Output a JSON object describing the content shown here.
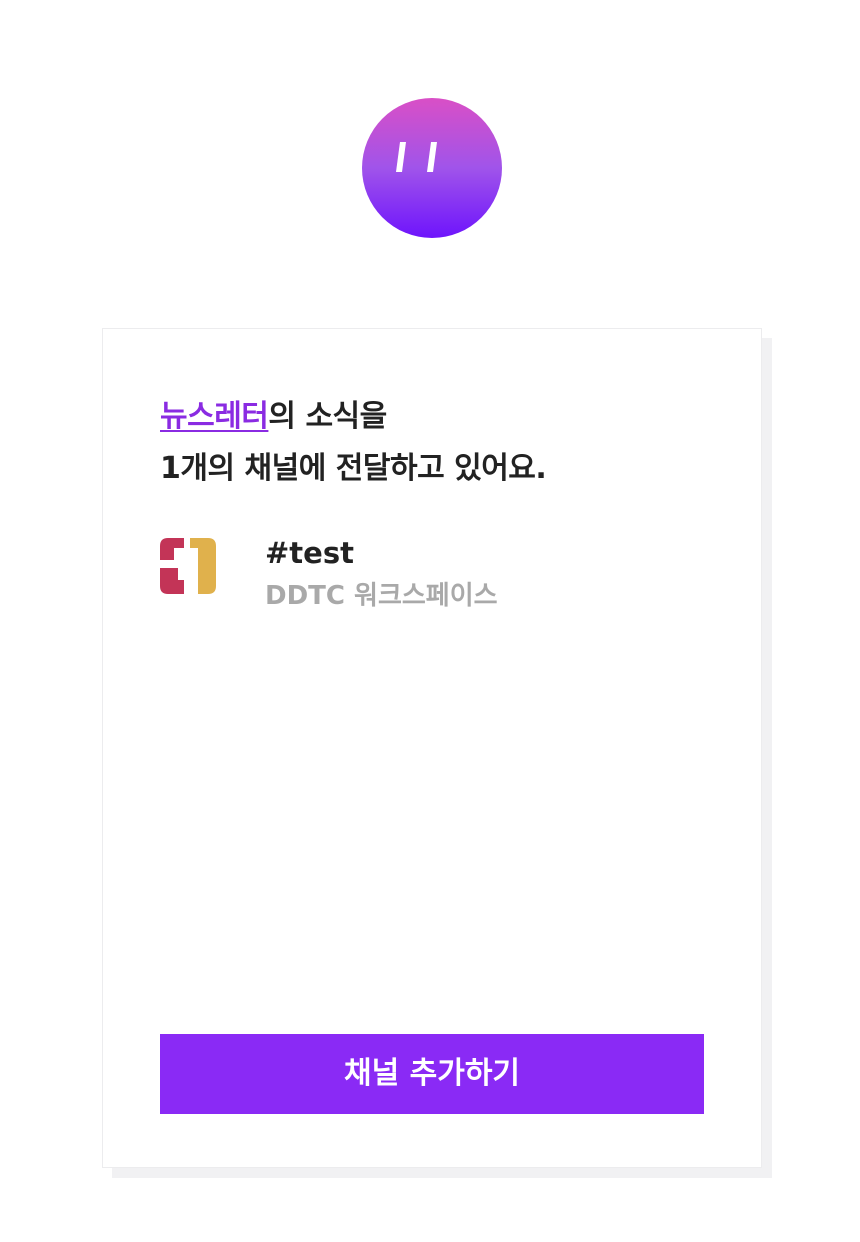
{
  "brand": {
    "logo_icon": "quote-marks-logo",
    "gradient": [
      "#d94fc6",
      "#a054ea",
      "#6e14fc"
    ]
  },
  "card": {
    "highlight_link": "뉴스레터",
    "headline_rest_line1": "의 소식을",
    "headline_line2": "1개의 채널에 전달하고 있어요.",
    "channel": {
      "icon": "slack-style-workspace-icon",
      "name": "#test",
      "workspace": "DDTC 워크스페이스"
    },
    "add_button_label": "채널 추가하기"
  },
  "colors": {
    "accent": "#8a2af5",
    "link": "#8a2be2",
    "text": "#222222",
    "muted": "#a9a9a9"
  }
}
